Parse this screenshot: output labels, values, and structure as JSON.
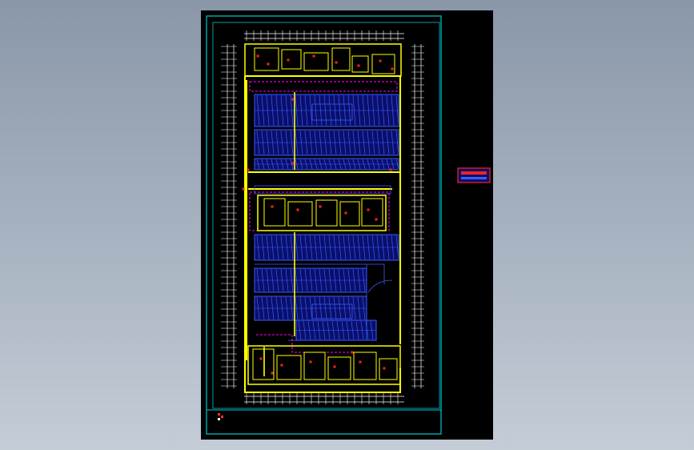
{
  "viewer": {
    "background_top": "#8a97a8",
    "background_bottom": "#c4ccd6"
  },
  "drawing": {
    "sheet_color": "#000000",
    "frame_color": "#00c8d2",
    "wall_color": "#ffff00",
    "parking_color": "#3a5cff",
    "fire_zone_color": "#ff00ff",
    "equipment_color": "#ff2020",
    "dimension_color": "#ffffff",
    "title_block_label_color": "#ff3030"
  },
  "floor_plan": {
    "parking_zones": 7,
    "service_blocks": [
      "top",
      "middle",
      "bottom"
    ]
  }
}
